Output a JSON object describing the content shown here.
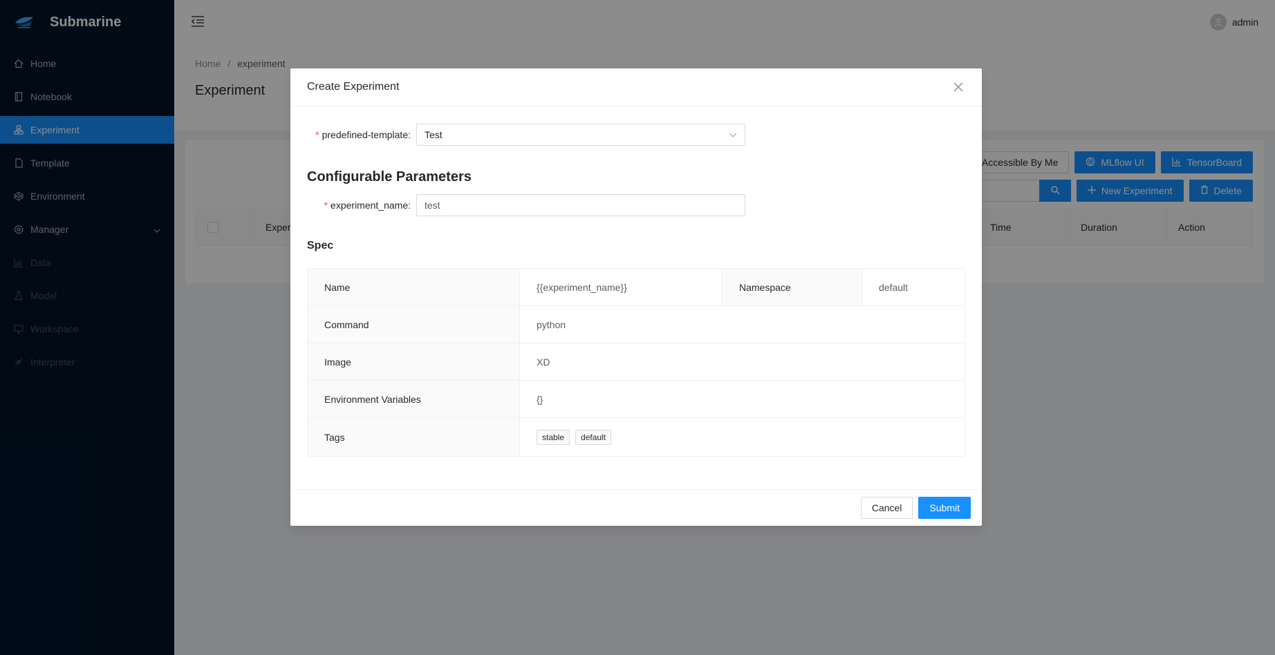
{
  "app": {
    "title": "Submarine"
  },
  "sidebar": {
    "items": [
      {
        "label": "Home",
        "icon": "home-icon"
      },
      {
        "label": "Notebook",
        "icon": "book-icon"
      },
      {
        "label": "Experiment",
        "icon": "cluster-icon",
        "active": true
      },
      {
        "label": "Template",
        "icon": "file-icon"
      },
      {
        "label": "Environment",
        "icon": "codepen-icon"
      },
      {
        "label": "Manager",
        "icon": "setting-icon",
        "expandable": true
      },
      {
        "label": "Data",
        "icon": "bar-chart-icon",
        "disabled": true
      },
      {
        "label": "Model",
        "icon": "experiment-icon",
        "disabled": true
      },
      {
        "label": "Workspace",
        "icon": "desktop-icon",
        "disabled": true
      },
      {
        "label": "Interpreter",
        "icon": "api-icon",
        "disabled": true
      }
    ]
  },
  "header": {
    "user": "admin"
  },
  "breadcrumb": {
    "home": "Home",
    "separator": "/",
    "current": "experiment"
  },
  "page": {
    "title": "Experiment"
  },
  "toolbar": {
    "accessible_label": "Accessible By Me",
    "mlflow_label": "MLflow UI",
    "tensorboard_label": "TensorBoard",
    "new_label": "New Experiment",
    "delete_label": "Delete"
  },
  "table": {
    "headers": [
      "Exper",
      "Time",
      "Duration",
      "Action"
    ]
  },
  "modal": {
    "title": "Create Experiment",
    "template_label": "predefined-template",
    "template_value": "Test",
    "section_title": "Configurable Parameters",
    "name_label": "experiment_name",
    "name_value": "test",
    "spec_title": "Spec",
    "spec": {
      "name_label": "Name",
      "name_value": "{{experiment_name}}",
      "namespace_label": "Namespace",
      "namespace_value": "default",
      "command_label": "Command",
      "command_value": "python",
      "image_label": "Image",
      "image_value": "XD",
      "env_label": "Environment Variables",
      "env_value": "{}",
      "tags_label": "Tags",
      "tags": [
        "stable",
        "default"
      ]
    },
    "cancel_label": "Cancel",
    "submit_label": "Submit"
  },
  "colors": {
    "primary": "#1890ff",
    "sidebar_bg": "#001529",
    "required": "#ff4d4f"
  }
}
